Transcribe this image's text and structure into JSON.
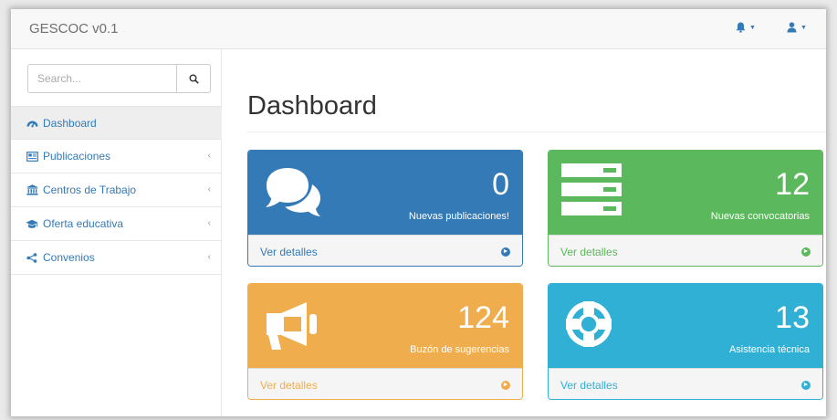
{
  "navbar": {
    "brand": "GESCOC v0.1",
    "alerts_icon": "bell-icon",
    "user_icon": "user-icon"
  },
  "sidebar": {
    "search": {
      "placeholder": "Search...",
      "value": "",
      "button_icon": "search-icon"
    },
    "items": [
      {
        "label": "Dashboard",
        "icon": "dashboard-icon",
        "active": true,
        "has_arrow": false
      },
      {
        "label": "Publicaciones",
        "icon": "newspaper-icon",
        "active": false,
        "has_arrow": true
      },
      {
        "label": "Centros de Trabajo",
        "icon": "institution-icon",
        "active": false,
        "has_arrow": true
      },
      {
        "label": "Oferta educativa",
        "icon": "graduation-cap-icon",
        "active": false,
        "has_arrow": true
      },
      {
        "label": "Convenios",
        "icon": "share-icon",
        "active": false,
        "has_arrow": true
      }
    ],
    "arrow_glyph": "‹"
  },
  "main": {
    "title": "Dashboard",
    "panels": [
      {
        "count": "0",
        "label": "Nuevas publicaciones!",
        "footer": "Ver detalles",
        "icon": "comments-icon",
        "color": "#337ab7"
      },
      {
        "count": "12",
        "label": "Nuevas convocatorias",
        "footer": "Ver detalles",
        "icon": "server-icon",
        "color": "#5cb85c"
      },
      {
        "count": "124",
        "label": "Buzón de sugerencias",
        "footer": "Ver detalles",
        "icon": "bullhorn-icon",
        "color": "#f0ad4e"
      },
      {
        "count": "13",
        "label": "Asistencia técnica",
        "footer": "Ver detalles",
        "icon": "life-ring-icon",
        "color": "#31b0d5"
      }
    ]
  },
  "colors": {
    "primary": "#337ab7",
    "green": "#5cb85c",
    "yellow": "#f0ad4e",
    "cyan": "#31b0d5"
  }
}
